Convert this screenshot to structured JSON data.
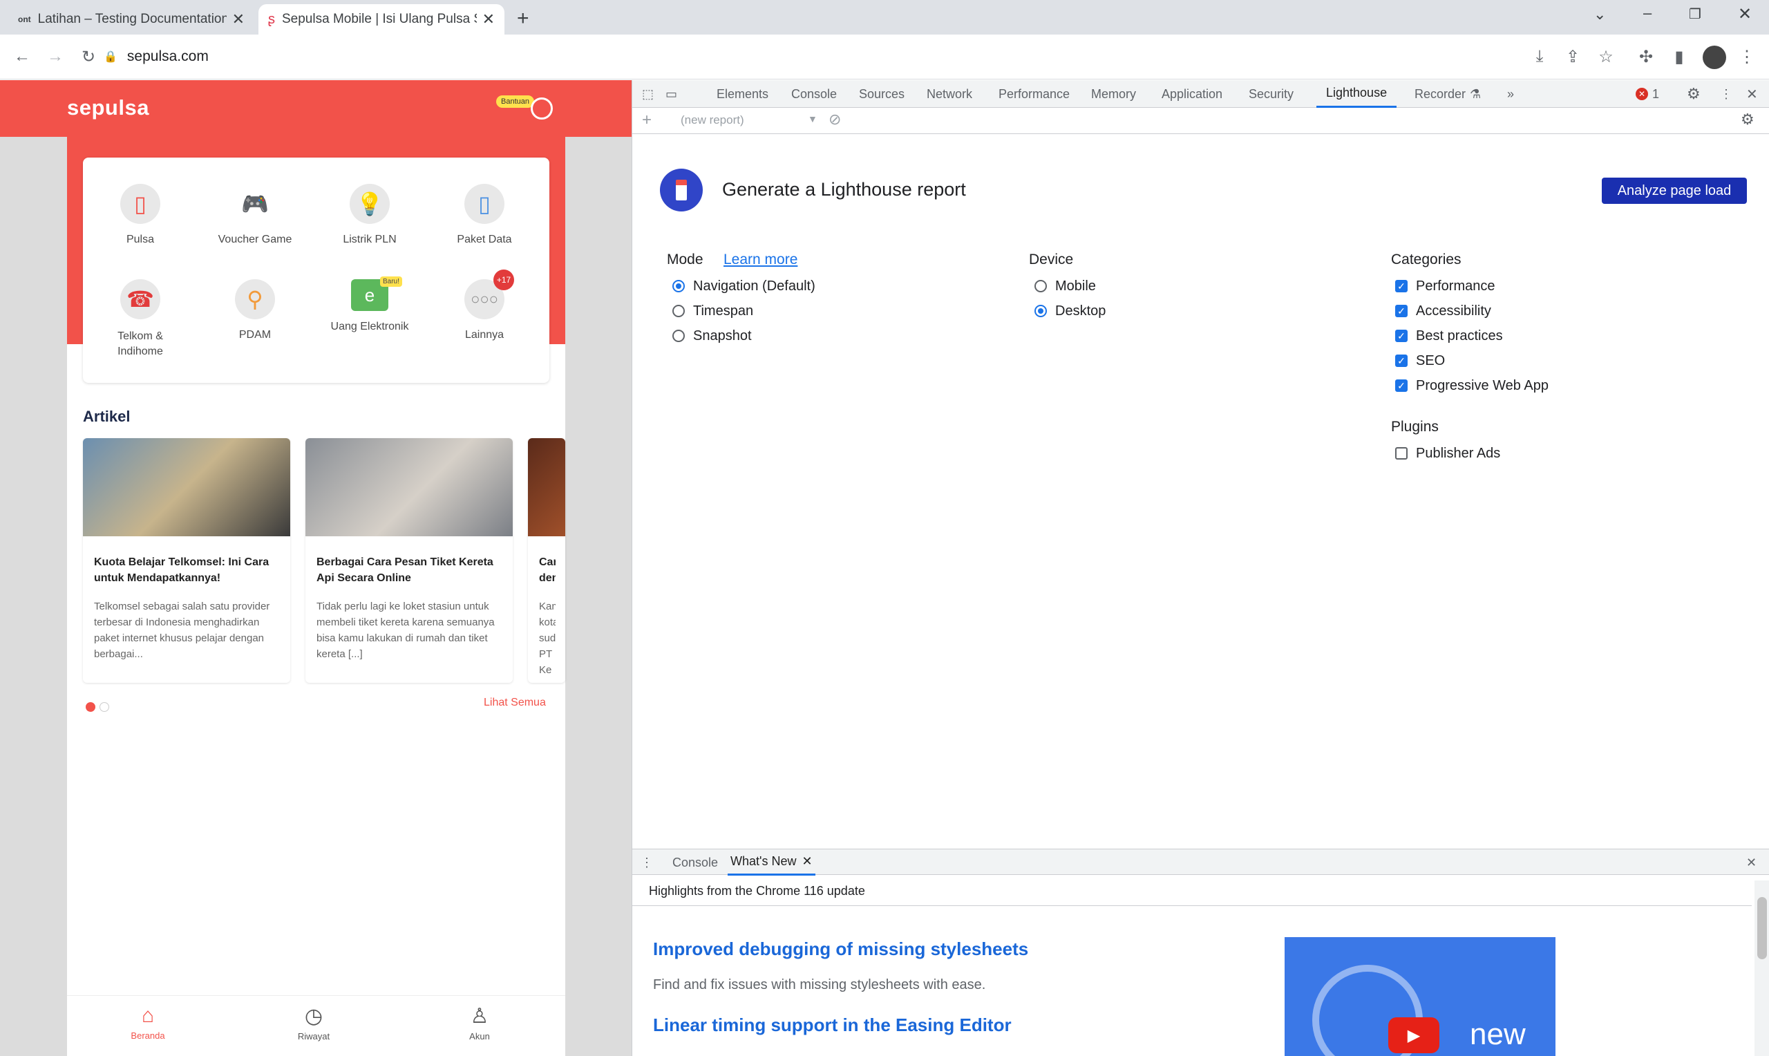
{
  "browser": {
    "tabs": [
      {
        "title": "Latihan – Testing Documentation",
        "favicon": "ont"
      },
      {
        "title": "Sepulsa Mobile | Isi Ulang Pulsa S",
        "favicon": "sepulsa"
      }
    ],
    "new_tab": "+",
    "url": "sepulsa.com"
  },
  "app": {
    "logo": "sepulsa",
    "bantuan": "Bantuan",
    "menu": [
      {
        "label": "Pulsa",
        "icon": "phone-icon"
      },
      {
        "label": "Voucher Game",
        "icon": "gamepad-icon"
      },
      {
        "label": "Listrik PLN",
        "icon": "bulb-icon"
      },
      {
        "label": "Paket Data",
        "icon": "phone-wifi-icon"
      },
      {
        "label": "Telkom & Indihome",
        "icon": "telephone-icon"
      },
      {
        "label": "PDAM",
        "icon": "faucet-icon"
      },
      {
        "label": "Uang Elektronik",
        "icon": "emoney-icon",
        "badge": "Baru!"
      },
      {
        "label": "Lainnya",
        "icon": "more-icon",
        "badge": "+17"
      }
    ],
    "artikel_title": "Artikel",
    "articles": [
      {
        "title": "Kuota Belajar Telkomsel: Ini Cara untuk Mendapatkannya!",
        "desc": "Telkomsel sebagai salah satu provider terbesar di Indonesia menghadirkan paket internet khusus pelajar dengan berbagai..."
      },
      {
        "title": "Berbagai Cara Pesan Tiket Kereta Api Secara Online",
        "desc": "Tidak perlu lagi ke loket stasiun untuk membeli tiket kereta karena semuanya bisa kamu lakukan di rumah dan tiket kereta [...]"
      },
      {
        "title": "Cara deng",
        "desc": "Kami kota suda PT Ke"
      }
    ],
    "lihat_semua": "Lihat Semua",
    "bottom_nav": [
      "Beranda",
      "Riwayat",
      "Akun"
    ]
  },
  "devtools": {
    "tabs": [
      "Elements",
      "Console",
      "Sources",
      "Network",
      "Performance",
      "Memory",
      "Application",
      "Security",
      "Lighthouse",
      "Recorder"
    ],
    "active_tab": "Lighthouse",
    "error_count": "1",
    "report_select": "(new report)",
    "lighthouse": {
      "title": "Generate a Lighthouse report",
      "analyze_button": "Analyze page load",
      "mode_label": "Mode",
      "learn_more": "Learn more",
      "modes": [
        "Navigation (Default)",
        "Timespan",
        "Snapshot"
      ],
      "selected_mode": "Navigation (Default)",
      "device_label": "Device",
      "devices": [
        "Mobile",
        "Desktop"
      ],
      "selected_device": "Desktop",
      "categories_label": "Categories",
      "categories": [
        "Performance",
        "Accessibility",
        "Best practices",
        "SEO",
        "Progressive Web App"
      ],
      "plugins_label": "Plugins",
      "plugins": [
        "Publisher Ads"
      ]
    },
    "drawer": {
      "tabs": [
        "Console",
        "What's New"
      ],
      "active": "What's New",
      "highlights": "Highlights from the Chrome 116 update",
      "items": [
        {
          "heading": "Improved debugging of missing stylesheets",
          "text": "Find and fix issues with missing stylesheets with ease."
        },
        {
          "heading": "Linear timing support in the Easing Editor",
          "text": ""
        }
      ],
      "video_caption": "new"
    }
  },
  "colors": {
    "brand_red": "#f2524a",
    "accent_blue": "#1a73e8",
    "analyze_blue": "#1a2fb0"
  }
}
